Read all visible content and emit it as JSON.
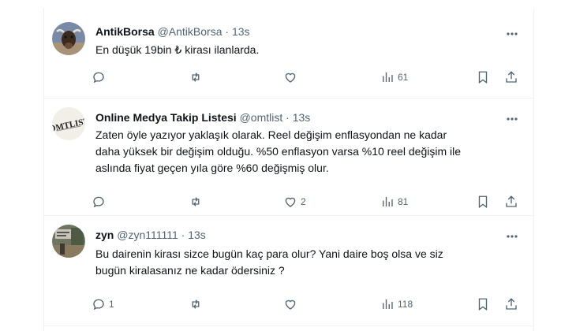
{
  "tweets": [
    {
      "name": "AntikBorsa",
      "handle": "@AntikBorsa",
      "dot": "·",
      "time": "13s",
      "text": "En düşük 19bin ₺ kirası ilanlarda.",
      "replies": "",
      "retweets": "",
      "likes": "",
      "views": "61",
      "avatar_icon": "bull-avatar-icon"
    },
    {
      "name": "Online Medya Takip Listesi",
      "handle": "@omtlist",
      "dot": "·",
      "time": "13s",
      "text": "Zaten öyle yazıyor yaklaşık olarak. Reel değişim enflasyondan ne kadar\ndaha yüksek bir değişim olduğu. %50 enflasyon varsa %10 reel değişim ile\naslında fiyat geçen yıla göre %60 değişmiş olur.",
      "replies": "",
      "retweets": "",
      "likes": "2",
      "views": "81",
      "avatar_icon": "omtlist-logo-avatar-icon"
    },
    {
      "name": "zyn",
      "handle": "@zyn111111",
      "dot": "·",
      "time": "13s",
      "text": "Bu dairenin kirası sizce bugün kaç para olur? Yani daire boş olsa ve siz\nbugün kiralasanız ne kadar ödersiniz ?",
      "replies": "1",
      "retweets": "",
      "likes": "",
      "views": "118",
      "avatar_icon": "photo-avatar-icon"
    }
  ],
  "colors": {
    "text": "#0f1419",
    "muted": "#536471",
    "border": "#eff3f4"
  }
}
